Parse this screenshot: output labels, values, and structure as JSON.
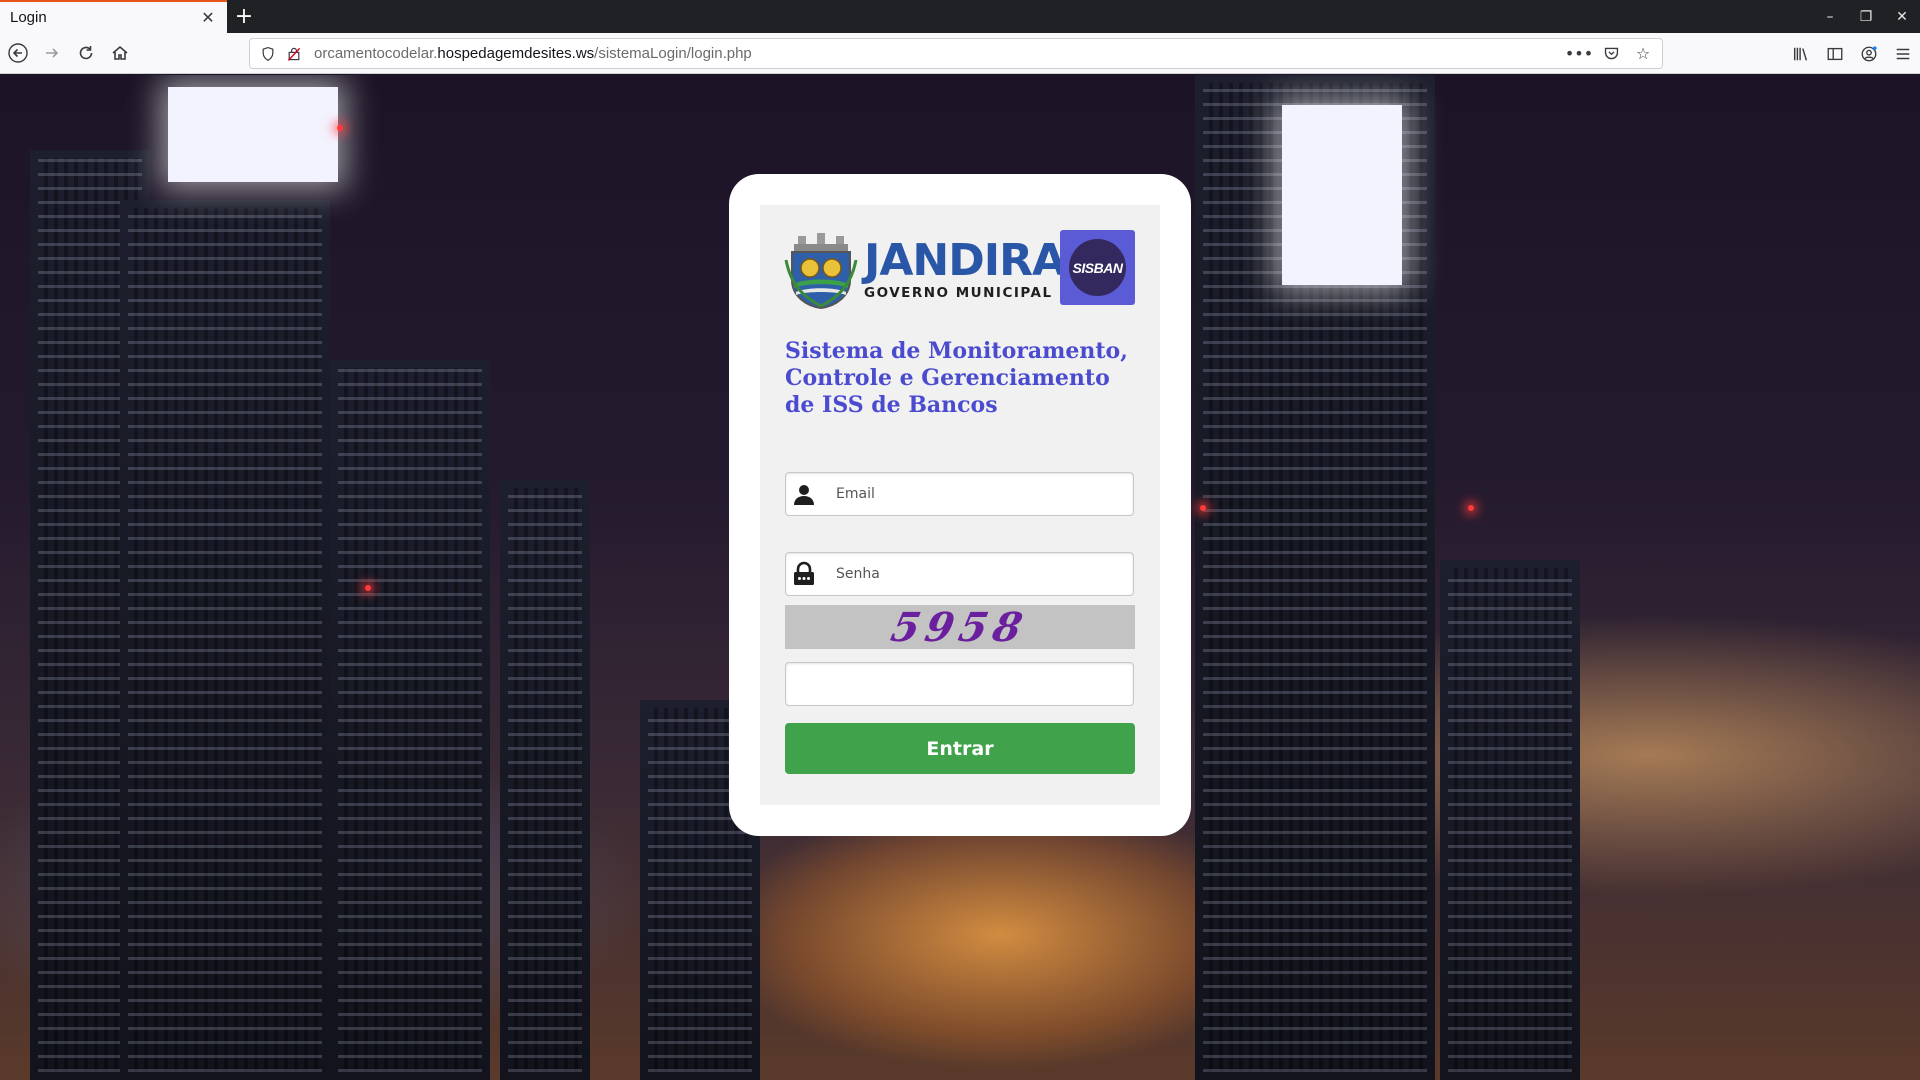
{
  "browser": {
    "tab_title": "Login",
    "tab_close_icon": "close-icon",
    "new_tab_icon": "plus-icon",
    "url": {
      "prefix": "orcamentocodelar.",
      "host": "hospedagemdesites.ws",
      "path": "/sistemaLogin/login.php"
    }
  },
  "logo": {
    "brand_name": "JANDIRA",
    "brand_subtitle": "GOVERNO MUNICIPAL",
    "badge_text": "SISBAN"
  },
  "login": {
    "title": "Sistema de Monitoramento, Controle e Gerenciamento de ISS de Bancos",
    "email_placeholder": "Email",
    "password_placeholder": "Senha",
    "captcha_text": "5958",
    "captcha_value": "",
    "submit_label": "Entrar"
  },
  "colors": {
    "title": "#4b4bd0",
    "button": "#40a24a",
    "badge": "#5b5bd6",
    "brand": "#2a56a8"
  }
}
